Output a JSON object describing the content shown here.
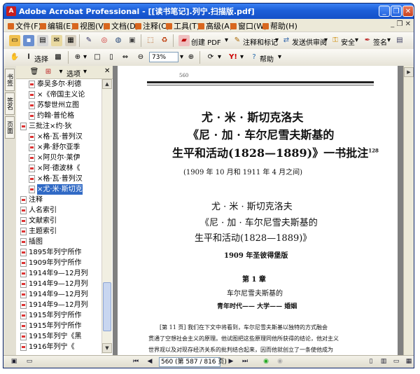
{
  "window": {
    "title": "Adobe Acrobat Professional - [[读书笔记].列宁.扫描版.pdf]",
    "minimize": "_",
    "restore": "❐",
    "close": "✕"
  },
  "menu": {
    "items": [
      "文件(F)",
      "编辑(E)",
      "视图(V)",
      "文档(D)",
      "注释(C)",
      "工具(T)",
      "高级(A)",
      "窗口(W)",
      "帮助(H)"
    ],
    "close_doc": "_ ❐ ✕"
  },
  "toolbar1": {
    "create_pdf": "创建 PDF",
    "comment": "注释和标记",
    "send_review": "发送供审阅",
    "secure": "安全",
    "sign": "签名"
  },
  "toolbar2": {
    "select": "选择",
    "zoom": "73%",
    "help": "帮助"
  },
  "nav_tabs": [
    "书签",
    "签名",
    "页面"
  ],
  "bookmarks": {
    "options": "选项",
    "items": [
      {
        "text": "泰吴多尔·利德",
        "indent": 1
      },
      {
        "text": "×《帝国主义论",
        "indent": 1
      },
      {
        "text": "苏黎世州立图",
        "indent": 1
      },
      {
        "text": "约翰·普伦格",
        "indent": 1
      },
      {
        "text": "三批注×约·狄",
        "indent": 0
      },
      {
        "text": "×格·瓦·普列汉",
        "indent": 1
      },
      {
        "text": "×弗·舒尔亚季",
        "indent": 1
      },
      {
        "text": "×阿贝尔·莱伊",
        "indent": 1
      },
      {
        "text": "×阿·德波林《",
        "indent": 1
      },
      {
        "text": "×格·瓦·普列汉",
        "indent": 1
      },
      {
        "text": "×尤·米·斯切克",
        "indent": 1,
        "selected": true
      },
      {
        "text": "注释",
        "indent": 0
      },
      {
        "text": "人名索引",
        "indent": 0
      },
      {
        "text": "文献索引",
        "indent": 0
      },
      {
        "text": "主题索引",
        "indent": 0
      },
      {
        "text": "插图",
        "indent": 0
      },
      {
        "text": "1895年列宁所作",
        "indent": 0
      },
      {
        "text": "1909年列宁所作",
        "indent": 0
      },
      {
        "text": "1914年9—12月列",
        "indent": 0
      },
      {
        "text": "1914年9—12月列",
        "indent": 0
      },
      {
        "text": "1914年9—12月列",
        "indent": 0
      },
      {
        "text": "1914年9—12月列",
        "indent": 0
      },
      {
        "text": "1915年列宁所作",
        "indent": 0
      },
      {
        "text": "1915年列宁所作",
        "indent": 0
      },
      {
        "text": "1915年列宁《黑",
        "indent": 0
      },
      {
        "text": "1916年列宁《",
        "indent": 0
      }
    ]
  },
  "page": {
    "page_no": "560",
    "h1": "尤 · 米 · 斯切克洛夫",
    "h2": "《尼 · 加 · 车尔尼雪夫斯基的",
    "h3": "生平和活动(1828—1889)》一书批注",
    "h3_sup": "128",
    "date_range": "(1909 年 10 月和 1911 年 4 月之间)",
    "t1": "尤 · 米 · 斯切克洛夫",
    "t2": "《尼 · 加 · 车尔尼雪夫斯基的",
    "t3": "生平和活动(1828—1889)》",
    "edition": "1909 年圣彼得堡版",
    "chapter": "第 1 章",
    "chapter_title": "车尔尼雪夫斯基的",
    "chapter_sub": "青年时代—— 大学—— 婚姻",
    "body1": "[第 11 页]   我们在下文中将看到，车尔尼雪夫斯基以独特的方式融会",
    "body2": "贯通了空想社会主义的原理。他试图把这些原理同他所获得的结论，他对主义",
    "body3": "世界观以及对现存经济关系的批判结合起来，因而他就创立了一条使他成为"
  },
  "status": {
    "page_box": "560 (第 587 / 816 页)"
  }
}
